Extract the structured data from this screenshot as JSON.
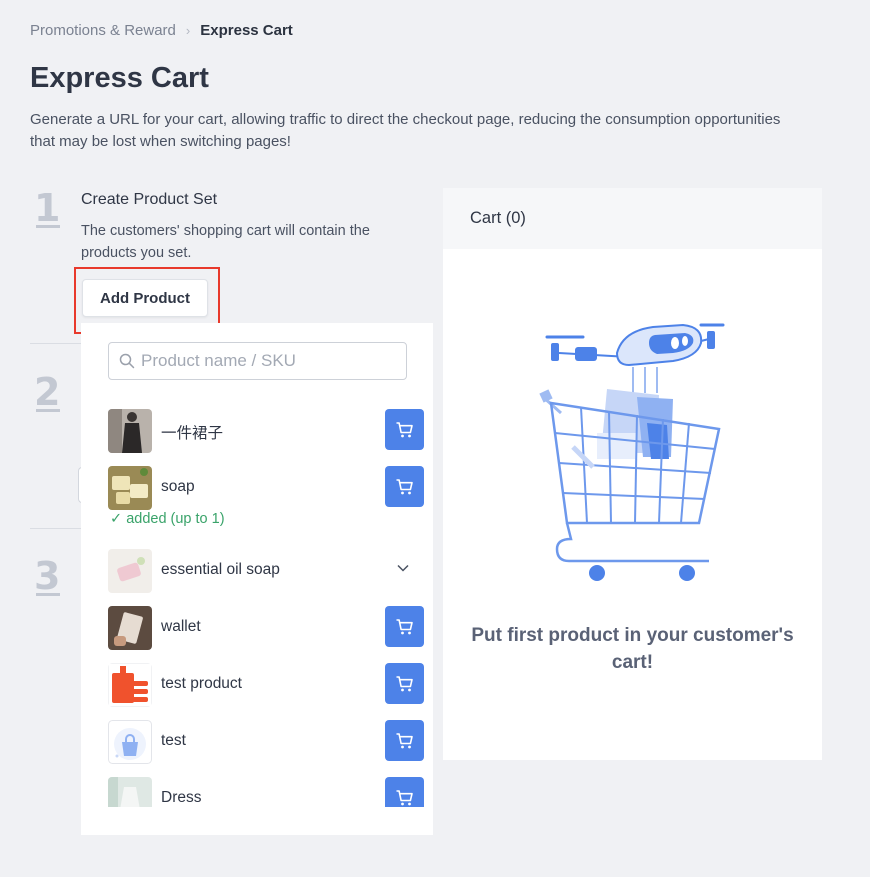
{
  "breadcrumb": {
    "parent": "Promotions & Reward",
    "separator": "›",
    "current": "Express Cart"
  },
  "page": {
    "title": "Express Cart",
    "description": "Generate a URL for your cart, allowing traffic to direct the checkout page, reducing the consumption opportunities that may be lost when switching pages!"
  },
  "steps": {
    "s1": {
      "number": "1",
      "title": "Create Product Set",
      "description": "The customers' shopping cart will contain the products you set.",
      "button": "Add Product"
    },
    "s2": {
      "number": "2"
    },
    "s3": {
      "number": "3"
    }
  },
  "dropdown": {
    "search_placeholder": "Product name / SKU",
    "items": [
      {
        "name": "一件裙子",
        "action": "add-to-cart"
      },
      {
        "name": "soap",
        "action": "add-to-cart",
        "status": "added (up to 1)"
      },
      {
        "name": "essential oil soap",
        "action": "expand"
      },
      {
        "name": "wallet",
        "action": "add-to-cart"
      },
      {
        "name": "test product",
        "action": "add-to-cart"
      },
      {
        "name": "test",
        "action": "add-to-cart"
      },
      {
        "name": "Dress",
        "action": "add-to-cart"
      }
    ]
  },
  "cart": {
    "header": "Cart (0)",
    "empty_message": "Put first product in your customer's cart!"
  },
  "colors": {
    "accent": "#4d82e8",
    "highlight": "#e8392b",
    "success": "#3aa36a"
  }
}
